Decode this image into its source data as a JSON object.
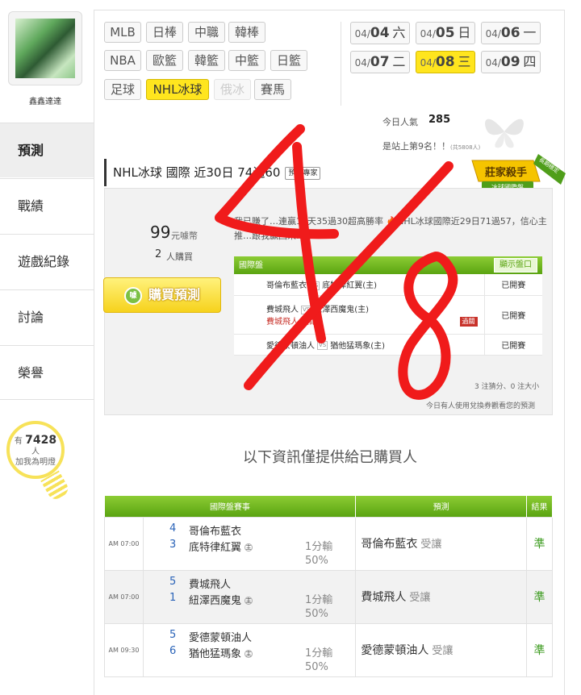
{
  "sidebar": {
    "username": "鑫鑫達達",
    "nav": [
      "預測",
      "戰績",
      "遊戲紀錄",
      "討論",
      "榮譽"
    ],
    "bulb": {
      "prefix": "有",
      "count": "7428",
      "suffix": "人",
      "text": "加我為明燈"
    }
  },
  "leagues": [
    [
      "MLB",
      "日棒",
      "中職",
      "韓棒"
    ],
    [
      "NBA",
      "歐籃",
      "韓籃",
      "中籃",
      "日籃"
    ],
    [
      "足球",
      "NHL冰球",
      "俄冰",
      "賽馬"
    ]
  ],
  "active_league": "NHL冰球",
  "disabled_league": "俄冰",
  "dates": [
    {
      "md": "04/",
      "d": "04",
      "wd": "六"
    },
    {
      "md": "04/",
      "d": "05",
      "wd": "日"
    },
    {
      "md": "04/",
      "d": "06",
      "wd": "一"
    },
    {
      "md": "04/",
      "d": "07",
      "wd": "二"
    },
    {
      "md": "04/",
      "d": "08",
      "wd": "三"
    },
    {
      "md": "04/",
      "d": "09",
      "wd": "四"
    }
  ],
  "popularity": {
    "label": "今日人氣",
    "value": "285",
    "rank_text": "是站上第9名！！",
    "rank_small": "(共5808人)"
  },
  "expert": {
    "title": "NHL冰球 國際 近30日 74過60",
    "tag": "預測專家",
    "badge_line1": "莊家殺手",
    "badge_line2": "冰球國際盤",
    "badge_ribbon": "長期穩定"
  },
  "price": {
    "value": "99",
    "unit": "元噱幣",
    "buyers": "2",
    "buyers_unit": "人購買",
    "buy_label": "購買預測",
    "coin_text": "噱"
  },
  "description": "我已賺了…連贏15天35過30超高勝率 🔥NHL冰球國際近29日71過57，信心主推…跟我贏回來…",
  "pick_table": {
    "header": "國際盤",
    "show_label": "顯示盤口",
    "rows": [
      {
        "away": "哥倫布藍衣",
        "home": "底特律紅翼(主)",
        "status": "已開賽",
        "sub": "",
        "tag": ""
      },
      {
        "away": "費城飛人",
        "home": "紐澤西魔鬼(主)",
        "status": "已開賽",
        "sub": "費城飛人 受讓",
        "tag": "過關"
      },
      {
        "away": "愛德蒙頓油人",
        "home": "猶他猛瑪象(主)",
        "status": "已開賽",
        "sub": "",
        "tag": ""
      }
    ],
    "vs": "VS",
    "summary": "3 注猜分、0 注大小",
    "notice": "今日有人使用兌換券觀看您的預測"
  },
  "info_banner": "以下資訊僅提供給已購買人",
  "history": {
    "headers": [
      "國際盤賽事",
      "預測",
      "結果"
    ],
    "rows": [
      {
        "time": "AM 07:00",
        "s1": "4",
        "t1": "哥倫布藍衣",
        "s2": "3",
        "t2": "底特律紅翼",
        "home": "主",
        "unit1": "1分輸",
        "unit2": "50%",
        "pick": "哥倫布藍衣",
        "note": "受讓",
        "result": "準"
      },
      {
        "time": "AM 07:00",
        "s1": "5",
        "t1": "費城飛人",
        "s2": "1",
        "t2": "紐澤西魔鬼",
        "home": "主",
        "unit1": "1分輸",
        "unit2": "50%",
        "pick": "費城飛人",
        "note": "受讓",
        "result": "準"
      },
      {
        "time": "AM 09:30",
        "s1": "5",
        "t1": "愛德蒙頓油人",
        "s2": "6",
        "t2": "猶他猛瑪象",
        "home": "主",
        "unit1": "1分輸",
        "unit2": "50%",
        "pick": "愛德蒙頓油人",
        "note": "受讓",
        "result": "準"
      }
    ]
  },
  "handwriting": "4/8",
  "colors": {
    "accent_yellow": "#ffe51e",
    "table_green": "#6ab41f",
    "ink_red": "#f01b1b",
    "score_blue": "#2a63b8",
    "result_green": "#3c9b1f"
  }
}
